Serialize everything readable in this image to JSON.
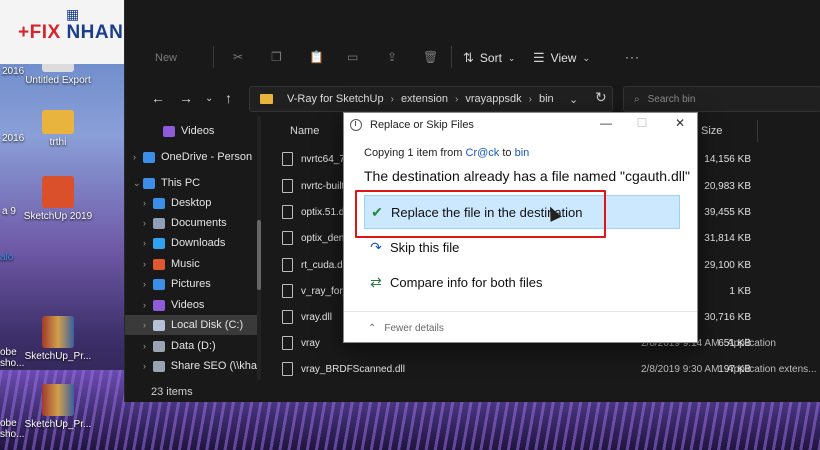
{
  "desktop": {
    "icons": [
      {
        "label": "Untitled Export",
        "color": "#dcdcdc"
      },
      {
        "label": "trthi",
        "color": "#e9b43d"
      },
      {
        "label": "SketchUp 2019",
        "color": "#d9502a"
      },
      {
        "label": "SketchUp_Pr...",
        "color": "#a03a2a"
      },
      {
        "label": "SketchUp_Pr...",
        "color": "#a03a2a"
      }
    ],
    "partial_labels": [
      "2016",
      "2016",
      "a 9",
      "alo",
      "obe",
      "sho...",
      "obe",
      "sho..."
    ]
  },
  "logo": {
    "plus": "+",
    "fix": "FIX",
    "nhanh": "NHANH"
  },
  "explorer": {
    "ghost_new": "New",
    "toolbar": {
      "sort": "Sort",
      "view": "View",
      "more": "···"
    },
    "address": {
      "crumbs": [
        "V-Ray for SketchUp",
        "extension",
        "vrayappsdk",
        "bin"
      ]
    },
    "search_placeholder": "Search bin",
    "nav": [
      {
        "label": "Videos",
        "icon": "videos-icon",
        "color": "#8e5bd9",
        "arrow": ""
      },
      {
        "label": "OneDrive - Person",
        "icon": "onedrive-icon",
        "color": "#3b8fe6",
        "arrow": "›"
      },
      {
        "label": "This PC",
        "icon": "computer-icon",
        "color": "#3b8fe6",
        "arrow": "⌄"
      },
      {
        "label": "Desktop",
        "icon": "desktop-icon",
        "color": "#3b8fe6",
        "arrow": "›"
      },
      {
        "label": "Documents",
        "icon": "documents-icon",
        "color": "#8f9fb8",
        "arrow": "›"
      },
      {
        "label": "Downloads",
        "icon": "downloads-icon",
        "color": "#31a2f2",
        "arrow": "›"
      },
      {
        "label": "Music",
        "icon": "music-icon",
        "color": "#e0582f",
        "arrow": "›"
      },
      {
        "label": "Pictures",
        "icon": "pictures-icon",
        "color": "#3b8fe6",
        "arrow": "›"
      },
      {
        "label": "Videos",
        "icon": "videos-icon",
        "color": "#8e5bd9",
        "arrow": "›"
      },
      {
        "label": "Local Disk (C:)",
        "icon": "drive-icon",
        "color": "#b7c2d6",
        "arrow": "›"
      },
      {
        "label": "Data (D:)",
        "icon": "drive-icon",
        "color": "#9aa3b2",
        "arrow": "›"
      },
      {
        "label": "Share SEO (\\\\kha",
        "icon": "network-drive-icon",
        "color": "#9aa3b2",
        "arrow": "›"
      }
    ],
    "columns": {
      "name": "Name",
      "size": "Size"
    },
    "files": [
      {
        "name": "nvrtc64_75...",
        "date": "",
        "type": "",
        "size": "14,156 KB"
      },
      {
        "name": "nvrtc-builti",
        "date": "",
        "type": "",
        "size": "20,983 KB"
      },
      {
        "name": "optix.51.dll",
        "date": "",
        "type": "",
        "size": "39,455 KB"
      },
      {
        "name": "optix_denc",
        "date": "",
        "type": "",
        "size": "31,814 KB"
      },
      {
        "name": "rt_cuda.dll",
        "date": "",
        "type": "",
        "size": "29,100 KB"
      },
      {
        "name": "v_ray_for_s",
        "date": "",
        "type": "",
        "size": "1 KB"
      },
      {
        "name": "vray.dll",
        "date": "",
        "type": "",
        "size": "30,716 KB"
      },
      {
        "name": "vray",
        "date": "2/8/2019 9:14 AM",
        "type": "Application",
        "size": "651 KB"
      },
      {
        "name": "vray_BRDFScanned.dll",
        "date": "2/8/2019 9:30 AM",
        "type": "Application extens...",
        "size": "197 KB"
      }
    ],
    "status": "23 items"
  },
  "dialog": {
    "title": "Replace or Skip Files",
    "copying_prefix": "Copying 1 item from",
    "source": "Cr@ck",
    "copying_mid": "to",
    "dest": "bin",
    "destination_text": "The destination already has a file named \"cgauth.dll\"",
    "options": {
      "replace": "Replace the file in the destination",
      "skip": "Skip this file",
      "compare": "Compare info for both files"
    },
    "fewer_details": "Fewer details"
  }
}
